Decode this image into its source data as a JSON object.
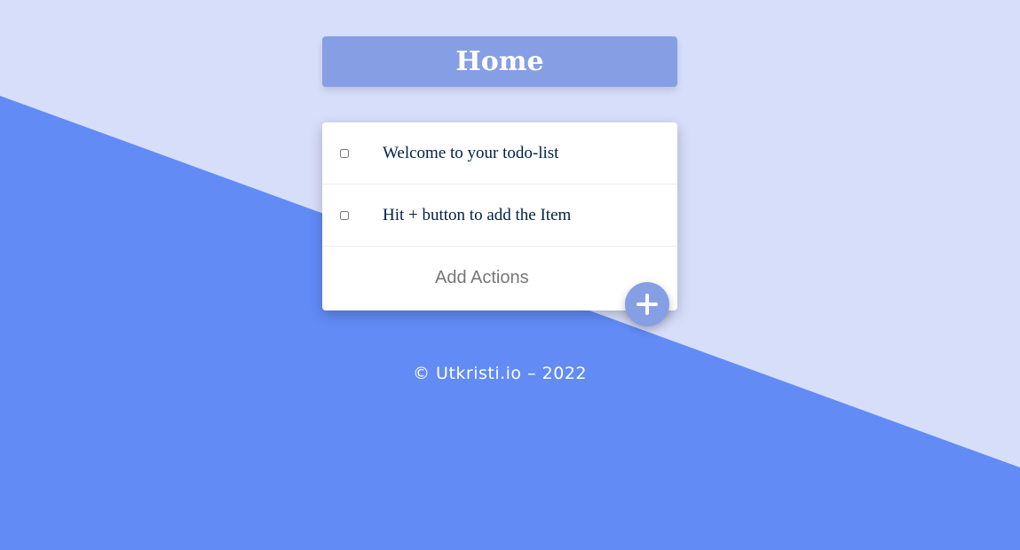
{
  "colors": {
    "background_light": "#d7defa",
    "background_dark": "#628bf6",
    "accent": "#869ee4",
    "card": "#ffffff",
    "item_text": "#00204a",
    "placeholder_text": "#777777"
  },
  "heading": {
    "title": "Home"
  },
  "todo": {
    "items": [
      {
        "text": "Welcome to your todo-list",
        "checked": false
      },
      {
        "text": "Hit + button to add the Item",
        "checked": false
      }
    ],
    "add_form": {
      "placeholder": "Add Actions",
      "button_icon": "plus-icon"
    }
  },
  "footer": {
    "text": "© Utkristi.io – 2022"
  }
}
